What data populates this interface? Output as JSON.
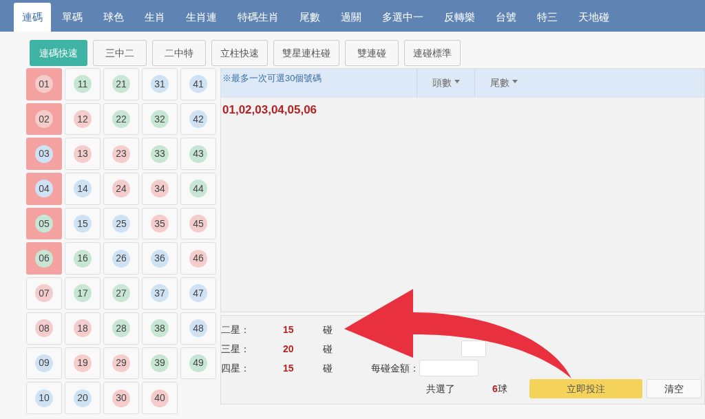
{
  "tabs": [
    {
      "label": "連碼",
      "selected": true
    },
    {
      "label": "單碼",
      "selected": false
    },
    {
      "label": "球色",
      "selected": false
    },
    {
      "label": "生肖",
      "selected": false
    },
    {
      "label": "生肖連",
      "selected": false
    },
    {
      "label": "特碼生肖",
      "selected": false
    },
    {
      "label": "尾數",
      "selected": false
    },
    {
      "label": "過關",
      "selected": false
    },
    {
      "label": "多選中一",
      "selected": false
    },
    {
      "label": "反轉樂",
      "selected": false
    },
    {
      "label": "台號",
      "selected": false
    },
    {
      "label": "特三",
      "selected": false
    },
    {
      "label": "天地碰",
      "selected": false
    }
  ],
  "modes": [
    {
      "label": "連碼快速",
      "selected": true
    },
    {
      "label": "三中二",
      "selected": false
    },
    {
      "label": "二中特",
      "selected": false
    },
    {
      "label": "立柱快速",
      "selected": false
    },
    {
      "label": "雙星連柱碰",
      "selected": false
    },
    {
      "label": "雙連碰",
      "selected": false
    },
    {
      "label": "連碰標準",
      "selected": false
    }
  ],
  "balls": [
    {
      "number": "01",
      "color": "#f4cccc",
      "selected": true
    },
    {
      "number": "02",
      "color": "#f4cccc",
      "selected": true
    },
    {
      "number": "03",
      "color": "#cfe2f3",
      "selected": true
    },
    {
      "number": "04",
      "color": "#cfe2f3",
      "selected": true
    },
    {
      "number": "05",
      "color": "#c8e6d4",
      "selected": true
    },
    {
      "number": "06",
      "color": "#c8e6d4",
      "selected": true
    },
    {
      "number": "07",
      "color": "#f4cccc",
      "selected": false
    },
    {
      "number": "08",
      "color": "#f4cccc",
      "selected": false
    },
    {
      "number": "09",
      "color": "#cfe2f3",
      "selected": false
    },
    {
      "number": "10",
      "color": "#cfe2f3",
      "selected": false
    },
    {
      "number": "11",
      "color": "#c8e6d4",
      "selected": false
    },
    {
      "number": "12",
      "color": "#f4cccc",
      "selected": false
    },
    {
      "number": "13",
      "color": "#f4cccc",
      "selected": false
    },
    {
      "number": "14",
      "color": "#cfe2f3",
      "selected": false
    },
    {
      "number": "15",
      "color": "#cfe2f3",
      "selected": false
    },
    {
      "number": "16",
      "color": "#c8e6d4",
      "selected": false
    },
    {
      "number": "17",
      "color": "#c8e6d4",
      "selected": false
    },
    {
      "number": "18",
      "color": "#f4cccc",
      "selected": false
    },
    {
      "number": "19",
      "color": "#f4cccc",
      "selected": false
    },
    {
      "number": "20",
      "color": "#cfe2f3",
      "selected": false
    },
    {
      "number": "21",
      "color": "#c8e6d4",
      "selected": false
    },
    {
      "number": "22",
      "color": "#c8e6d4",
      "selected": false
    },
    {
      "number": "23",
      "color": "#f4cccc",
      "selected": false
    },
    {
      "number": "24",
      "color": "#f4cccc",
      "selected": false
    },
    {
      "number": "25",
      "color": "#cfe2f3",
      "selected": false
    },
    {
      "number": "26",
      "color": "#cfe2f3",
      "selected": false
    },
    {
      "number": "27",
      "color": "#c8e6d4",
      "selected": false
    },
    {
      "number": "28",
      "color": "#c8e6d4",
      "selected": false
    },
    {
      "number": "29",
      "color": "#f4cccc",
      "selected": false
    },
    {
      "number": "30",
      "color": "#f4cccc",
      "selected": false
    },
    {
      "number": "31",
      "color": "#cfe2f3",
      "selected": false
    },
    {
      "number": "32",
      "color": "#c8e6d4",
      "selected": false
    },
    {
      "number": "33",
      "color": "#c8e6d4",
      "selected": false
    },
    {
      "number": "34",
      "color": "#f4cccc",
      "selected": false
    },
    {
      "number": "35",
      "color": "#f4cccc",
      "selected": false
    },
    {
      "number": "36",
      "color": "#cfe2f3",
      "selected": false
    },
    {
      "number": "37",
      "color": "#cfe2f3",
      "selected": false
    },
    {
      "number": "38",
      "color": "#c8e6d4",
      "selected": false
    },
    {
      "number": "39",
      "color": "#c8e6d4",
      "selected": false
    },
    {
      "number": "40",
      "color": "#f4cccc",
      "selected": false
    },
    {
      "number": "41",
      "color": "#cfe2f3",
      "selected": false
    },
    {
      "number": "42",
      "color": "#cfe2f3",
      "selected": false
    },
    {
      "number": "43",
      "color": "#c8e6d4",
      "selected": false
    },
    {
      "number": "44",
      "color": "#c8e6d4",
      "selected": false
    },
    {
      "number": "45",
      "color": "#f4cccc",
      "selected": false
    },
    {
      "number": "46",
      "color": "#f4cccc",
      "selected": false
    },
    {
      "number": "47",
      "color": "#cfe2f3",
      "selected": false
    },
    {
      "number": "48",
      "color": "#cfe2f3",
      "selected": false
    },
    {
      "number": "49",
      "color": "#c8e6d4",
      "selected": false
    }
  ],
  "selection_panel": {
    "note": "※最多一次可選30個號碼",
    "filters": [
      "頭數",
      "尾數"
    ],
    "selected_numbers": "01,02,03,04,05,06"
  },
  "combos": [
    {
      "label": "二星：",
      "count": "15",
      "unit": "碰"
    },
    {
      "label": "三星：",
      "count": "20",
      "unit": "碰"
    },
    {
      "label": "四星：",
      "count": "15",
      "unit": "碰"
    }
  ],
  "amount_field": {
    "label": "每碰金額："
  },
  "summary": {
    "label": "共選了",
    "count": "6",
    "unit": "球"
  },
  "buttons": [
    "立即投注",
    "清空"
  ]
}
